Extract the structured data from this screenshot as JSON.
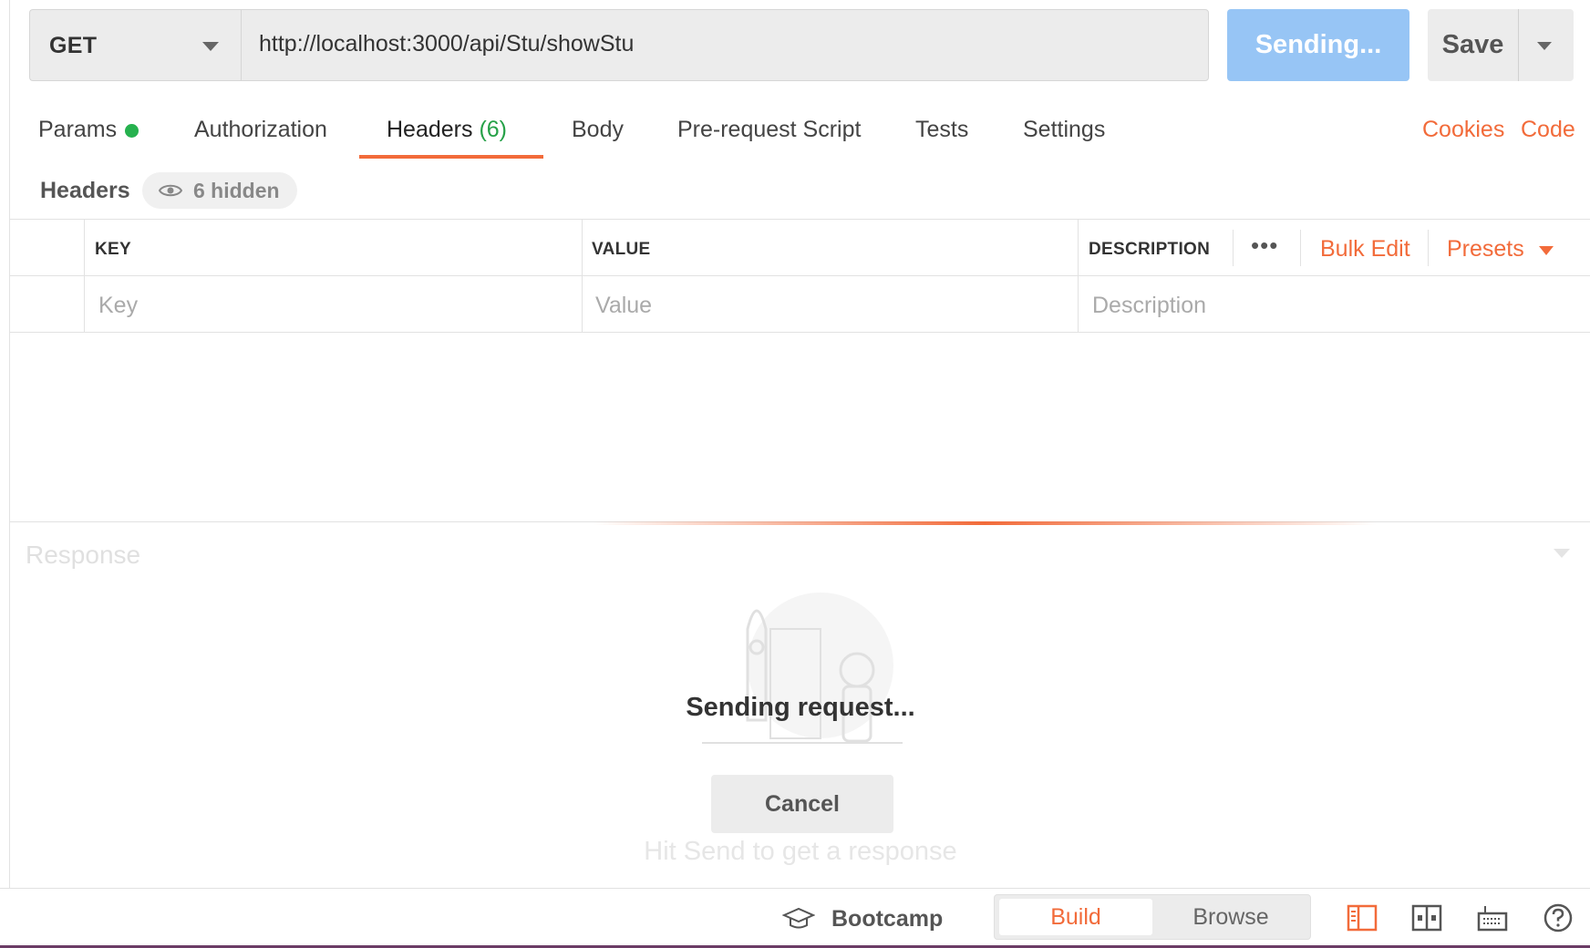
{
  "request": {
    "method": "GET",
    "url": "http://localhost:3000/api/Stu/showStu",
    "send_label": "Sending...",
    "save_label": "Save"
  },
  "tabs": {
    "params": "Params",
    "authorization": "Authorization",
    "headers": "Headers",
    "headers_count": "(6)",
    "body": "Body",
    "prerequest": "Pre-request Script",
    "tests": "Tests",
    "settings": "Settings",
    "active": "Headers"
  },
  "links": {
    "cookies": "Cookies",
    "code": "Code"
  },
  "headers_section": {
    "title": "Headers",
    "hidden_label": "6 hidden"
  },
  "table": {
    "columns": [
      "KEY",
      "VALUE",
      "DESCRIPTION"
    ],
    "more_icon": "ellipsis-icon",
    "bulk_edit": "Bulk Edit",
    "presets": "Presets",
    "placeholders": {
      "key": "Key",
      "value": "Value",
      "description": "Description"
    }
  },
  "response": {
    "title": "Response",
    "status_text": "Sending request...",
    "cancel_label": "Cancel",
    "hint": "Hit Send to get a response"
  },
  "footer": {
    "bootcamp": "Bootcamp",
    "build": "Build",
    "browse": "Browse",
    "active_mode": "Build",
    "icons": [
      "two-pane-icon",
      "split-view-icon",
      "keyboard-icon",
      "help-icon"
    ]
  },
  "colors": {
    "accent": "#f26b3a",
    "send_button": "#97c5f5",
    "params_dot": "#26b14e",
    "headers_count": "#26a148"
  }
}
